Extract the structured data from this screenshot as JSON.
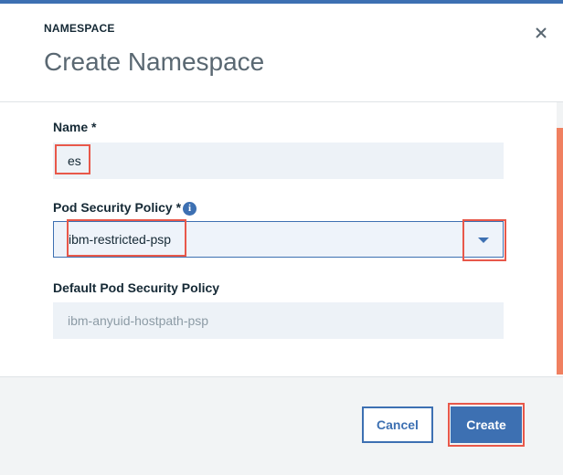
{
  "modal": {
    "eyebrow": "NAMESPACE",
    "title": "Create Namespace",
    "close_icon": "close-icon"
  },
  "form": {
    "name": {
      "label": "Name *",
      "value": "es"
    },
    "psp": {
      "label": "Pod Security Policy *",
      "value": "ibm-restricted-psp",
      "info_icon": "i"
    },
    "default_psp": {
      "label": "Default Pod Security Policy",
      "value": "ibm-anyuid-hostpath-psp"
    }
  },
  "footer": {
    "cancel_label": "Cancel",
    "create_label": "Create"
  },
  "colors": {
    "accent": "#3d70b2",
    "highlight": "#e8584a",
    "scroll": "#f08060"
  }
}
